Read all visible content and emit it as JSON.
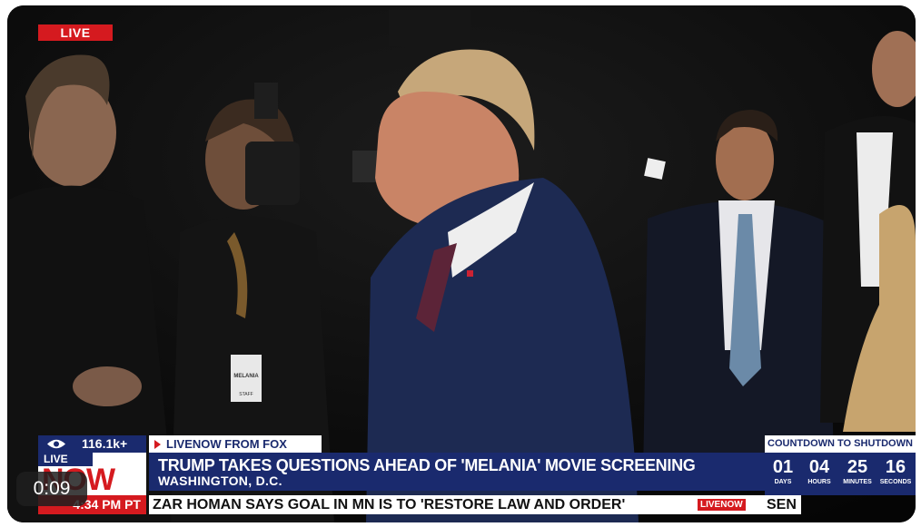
{
  "video": {
    "live_badge": "LIVE",
    "elapsed": "0:09"
  },
  "overlay": {
    "views": "116.1k+",
    "source_label": "LIVENOW FROM FOX",
    "logo_top": "LIVE",
    "logo_bottom": "NOW",
    "headline": "TRUMP TAKES QUESTIONS AHEAD OF 'MELANIA' MOVIE SCREENING",
    "location": "WASHINGTON, D.C.",
    "time": "4:34 PM PT",
    "ticker_text": "ZAR HOMAN SAYS GOAL IN MN IS TO 'RESTORE LAW AND ORDER'",
    "ticker_logo": "LIVENOW",
    "ticker_next": "SEN"
  },
  "countdown": {
    "title": "COUNTDOWN TO SHUTDOWN",
    "units": [
      {
        "value": "01",
        "label": "DAYS"
      },
      {
        "value": "04",
        "label": "HOURS"
      },
      {
        "value": "25",
        "label": "MINUTES"
      },
      {
        "value": "16",
        "label": "SECONDS"
      }
    ]
  },
  "badge": {
    "name": "MELANIA",
    "sub": "STAFF"
  },
  "colors": {
    "fox_navy": "#1a2a6e",
    "fox_red": "#d51a1f"
  }
}
